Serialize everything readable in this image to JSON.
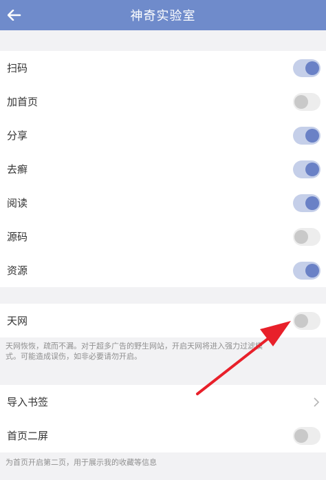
{
  "header": {
    "title": "神奇实验室",
    "color": "#6f8bcb"
  },
  "settings": [
    {
      "label": "扫码",
      "enabled": true
    },
    {
      "label": "加首页",
      "enabled": false
    },
    {
      "label": "分享",
      "enabled": true
    },
    {
      "label": "去癣",
      "enabled": true
    },
    {
      "label": "阅读",
      "enabled": true
    },
    {
      "label": "源码",
      "enabled": false
    },
    {
      "label": "资源",
      "enabled": true
    }
  ],
  "skynet": {
    "label": "天网",
    "enabled": false,
    "description_line1": "天网恢恢，疏而不漏。对于超多广告的野生网站，开启天网将进入强力过滤模",
    "description_line2": "式。可能造成误伤，如非必要请勿开启。"
  },
  "import_bookmarks": {
    "label": "导入书签",
    "icon": "chevron-right-icon"
  },
  "second_screen": {
    "label": "首页二屏",
    "enabled": false,
    "description": "为首页开启第二页，用于展示我的收藏等信息"
  },
  "colors": {
    "accent": "#6a81c6",
    "toggle_on_track": "#c5cfe9",
    "toggle_off_track": "#ededed",
    "annotation_arrow": "#e8202a"
  }
}
